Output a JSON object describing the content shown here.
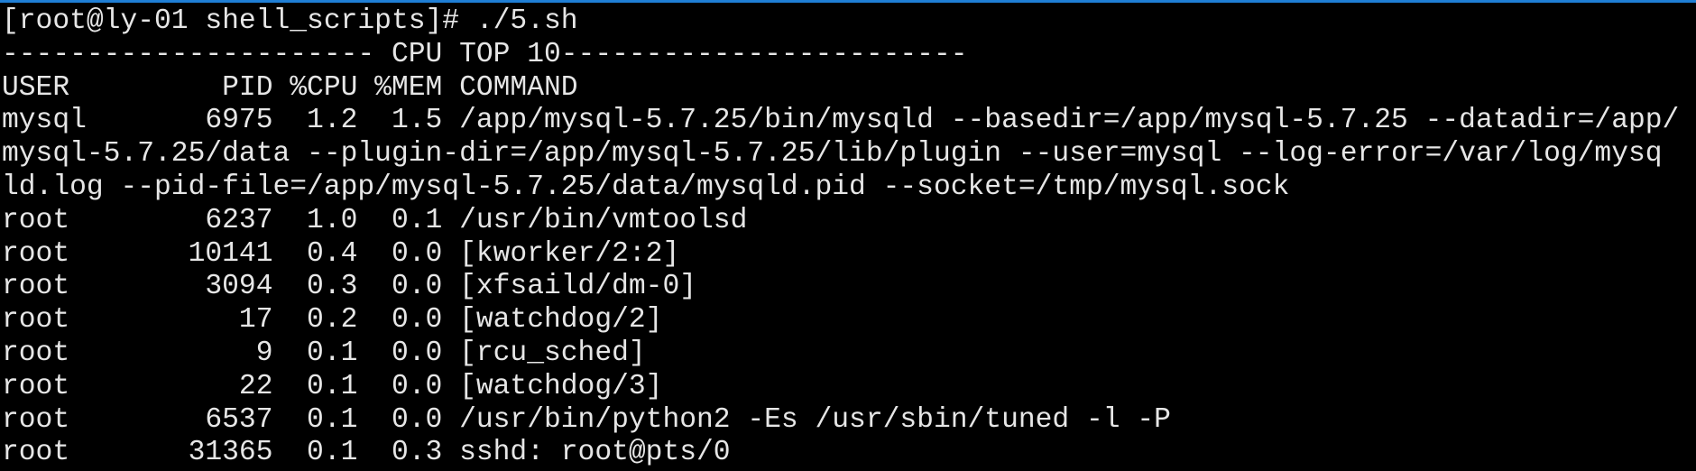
{
  "terminal": {
    "accent_color": "#1f7fd6",
    "lines": [
      "[root@ly-01 shell_scripts]# ./5.sh",
      "---------------------- CPU TOP 10------------------------",
      "USER         PID %CPU %MEM COMMAND",
      "mysql       6975  1.2  1.5 /app/mysql-5.7.25/bin/mysqld --basedir=/app/mysql-5.7.25 --datadir=/app/",
      "mysql-5.7.25/data --plugin-dir=/app/mysql-5.7.25/lib/plugin --user=mysql --log-error=/var/log/mysq",
      "ld.log --pid-file=/app/mysql-5.7.25/data/mysqld.pid --socket=/tmp/mysql.sock",
      "root        6237  1.0  0.1 /usr/bin/vmtoolsd",
      "root       10141  0.4  0.0 [kworker/2:2]",
      "root        3094  0.3  0.0 [xfsaild/dm-0]",
      "root          17  0.2  0.0 [watchdog/2]",
      "root           9  0.1  0.0 [rcu_sched]",
      "root          22  0.1  0.0 [watchdog/3]",
      "root        6537  0.1  0.0 /usr/bin/python2 -Es /usr/sbin/tuned -l -P",
      "root       31365  0.1  0.3 sshd: root@pts/0"
    ]
  }
}
